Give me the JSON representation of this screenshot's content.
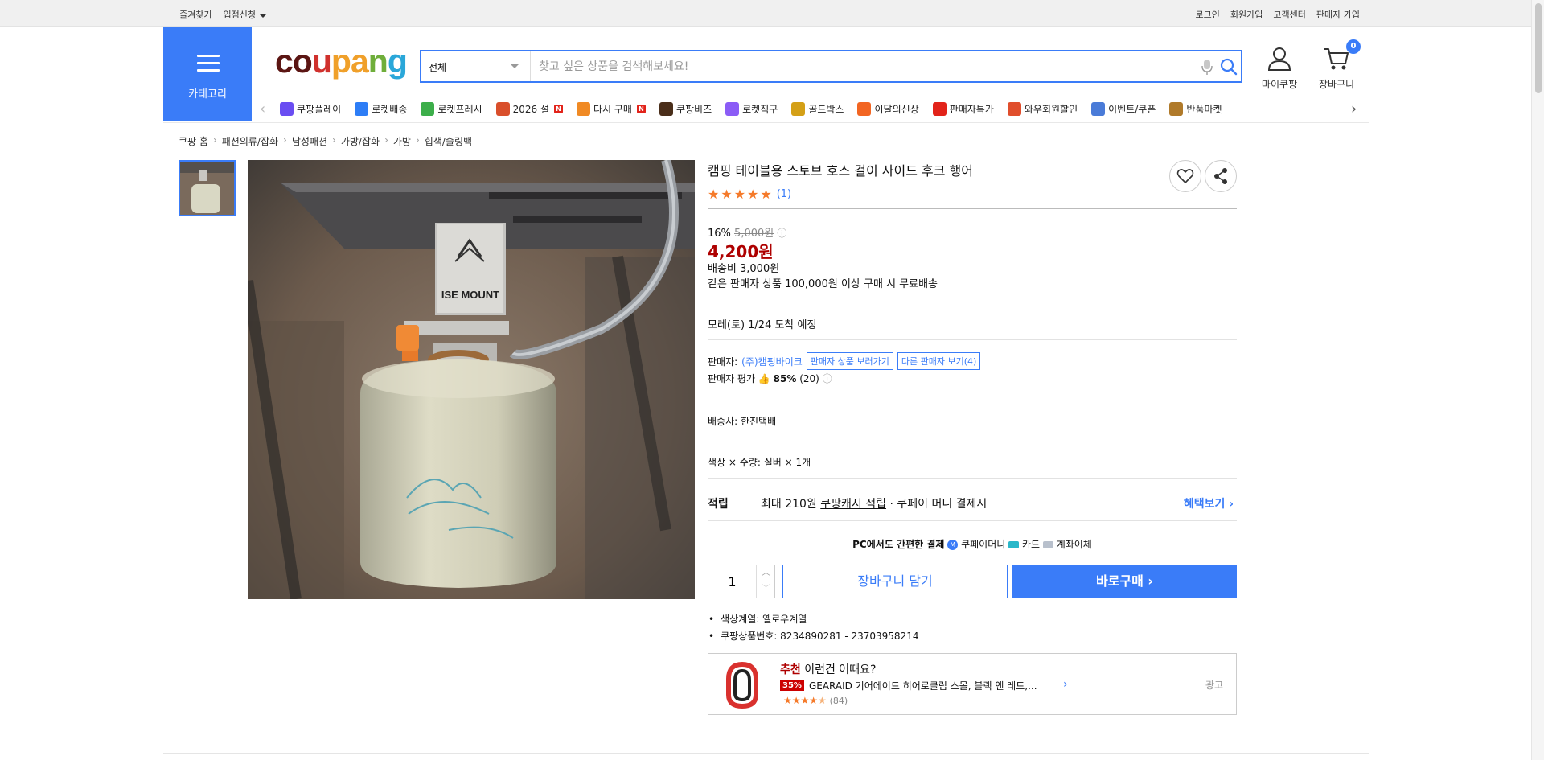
{
  "topbar": {
    "left": [
      "즐겨찾기",
      "입점신청"
    ],
    "right": [
      "로그인",
      "회원가입",
      "고객센터",
      "판매자 가입"
    ]
  },
  "header": {
    "category_label": "카테고리",
    "logo": [
      "co",
      "u",
      "pa",
      "n",
      "g"
    ],
    "search": {
      "scope": "전체",
      "placeholder": "찾고 싶은 상품을 검색해보세요!"
    },
    "mycoupang_label": "마이쿠팡",
    "cart_label": "장바구니",
    "cart_count": "0"
  },
  "nav": [
    {
      "label": "쿠팡플레이",
      "icon": "play-icon",
      "color": "#6a4df2",
      "new": false
    },
    {
      "label": "로켓배송",
      "icon": "rocket-icon",
      "color": "#2d7df6",
      "new": false
    },
    {
      "label": "로켓프레시",
      "icon": "rocket-fresh-icon",
      "color": "#3cae4a",
      "new": false
    },
    {
      "label": "2026 설",
      "icon": "hanbok-icon",
      "color": "#d94f2b",
      "new": true
    },
    {
      "label": "다시 구매",
      "icon": "home-icon",
      "color": "#f08a24",
      "new": true
    },
    {
      "label": "쿠팡비즈",
      "icon": "biz-icon",
      "color": "#4a2e1a",
      "new": false
    },
    {
      "label": "로켓직구",
      "icon": "globe-rocket-icon",
      "color": "#8b5cf6",
      "new": false
    },
    {
      "label": "골드박스",
      "icon": "gift-box-icon",
      "color": "#d4a017",
      "new": false
    },
    {
      "label": "이달의신상",
      "icon": "shopping-bag-icon",
      "color": "#f26522",
      "new": false
    },
    {
      "label": "판매자특가",
      "icon": "percent-icon",
      "color": "#e2231a",
      "new": false
    },
    {
      "label": "와우회원할인",
      "icon": "wow-icon",
      "color": "#e04e2c",
      "new": false
    },
    {
      "label": "이벤트/쿠폰",
      "icon": "coupon-icon",
      "color": "#4a7bd8",
      "new": false
    },
    {
      "label": "반품마켓",
      "icon": "market-icon",
      "color": "#b07a2a",
      "new": false
    }
  ],
  "breadcrumb": [
    "쿠팡 홈",
    "패션의류/잡화",
    "남성패션",
    "가방/잡화",
    "가방",
    "힙색/슬링백"
  ],
  "product": {
    "title": "캠핑 테이블용 스토브 호스 걸이 사이드 후크 행어",
    "rating": 5,
    "review_count": "(1)",
    "discount": "16%",
    "original_price": "5,000원",
    "price": "4,200원",
    "shipping_fee": "배송비 3,000원",
    "free_shipping": "같은 판매자 상품 100,000원 이상 구매 시 무료배송",
    "arrival": "모레(토) 1/24 도착 예정",
    "seller_label": "판매자:",
    "seller_name": "(주)캠핑바이크",
    "seller_products_button": "판매자 상품 보러가기",
    "other_sellers_button": "다른 판매자 보기(4)",
    "seller_rating_label": "판매자 평가",
    "seller_rating": "85%",
    "seller_rating_count": "(20)",
    "courier": "배송사:  한진택배",
    "option": "색상 × 수량: 실버 × 1개",
    "reward": {
      "label": "적립",
      "text_prefix": "최대 210원 ",
      "cash_link": "쿠팡캐시 적립",
      "text_suffix": " · 쿠페이 머니 결제시",
      "more": "혜택보기"
    },
    "pay": {
      "title": "PC에서도 간편한 결제",
      "methods": [
        "쿠페이머니",
        "카드",
        "계좌이체"
      ]
    },
    "quantity": "1",
    "cart_button": "장바구니 담기",
    "buy_button": "바로구매",
    "details": [
      "색상계열: 옐로우계열",
      "쿠팡상품번호: 8234890281 - 23703958214"
    ],
    "image_brand_text": "ISE MOUNT"
  },
  "recommend": {
    "heading_red": "추천",
    "heading": " 이런건 어때요?",
    "discount": "35%",
    "name": "GEARAID 기어에이드 히어로클립 스몰, 블랙 앤 레드,...",
    "rating": 4.5,
    "count": "(84)",
    "ad_label": "광고"
  }
}
